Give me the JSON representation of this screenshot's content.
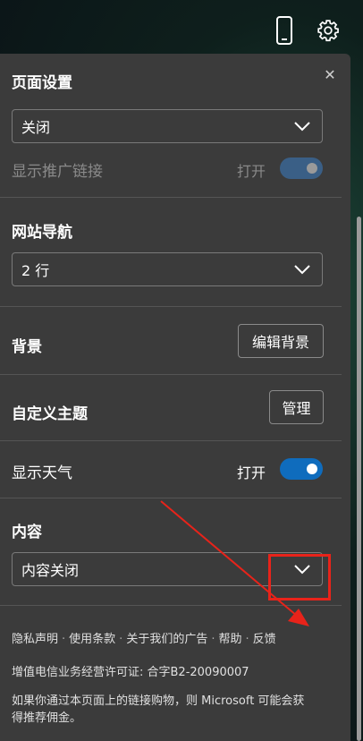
{
  "header": {
    "icons": [
      "phone-icon",
      "gear-icon"
    ]
  },
  "panel": {
    "close_icon": "close-icon",
    "page_settings": {
      "title": "页面设置",
      "layout_select": "关闭",
      "promo_links_label": "显示推广链接",
      "promo_links_state": "打开"
    },
    "site_nav": {
      "title": "网站导航",
      "rows_select": "2 行"
    },
    "background": {
      "label": "背景",
      "button": "编辑背景"
    },
    "custom_theme": {
      "label": "自定义主题",
      "button": "管理"
    },
    "weather": {
      "label": "显示天气",
      "state": "打开"
    },
    "content": {
      "title": "内容",
      "select": "内容关闭"
    },
    "footer": {
      "links": [
        "隐私声明",
        "使用条款",
        "关于我们的广告",
        "帮助",
        "反馈"
      ],
      "separator": "·",
      "license": "增值电信业务经营许可证: 合字B2-20090007",
      "affiliate": "如果你通过本页面上的链接购物，则 Microsoft 可能会获得推荐佣金。"
    }
  },
  "colors": {
    "panel_bg": "#3b3b3b",
    "toggle_on": "#0f6cbd",
    "toggle_disabled": "#3a5f86",
    "annotation": "#e8231a"
  }
}
